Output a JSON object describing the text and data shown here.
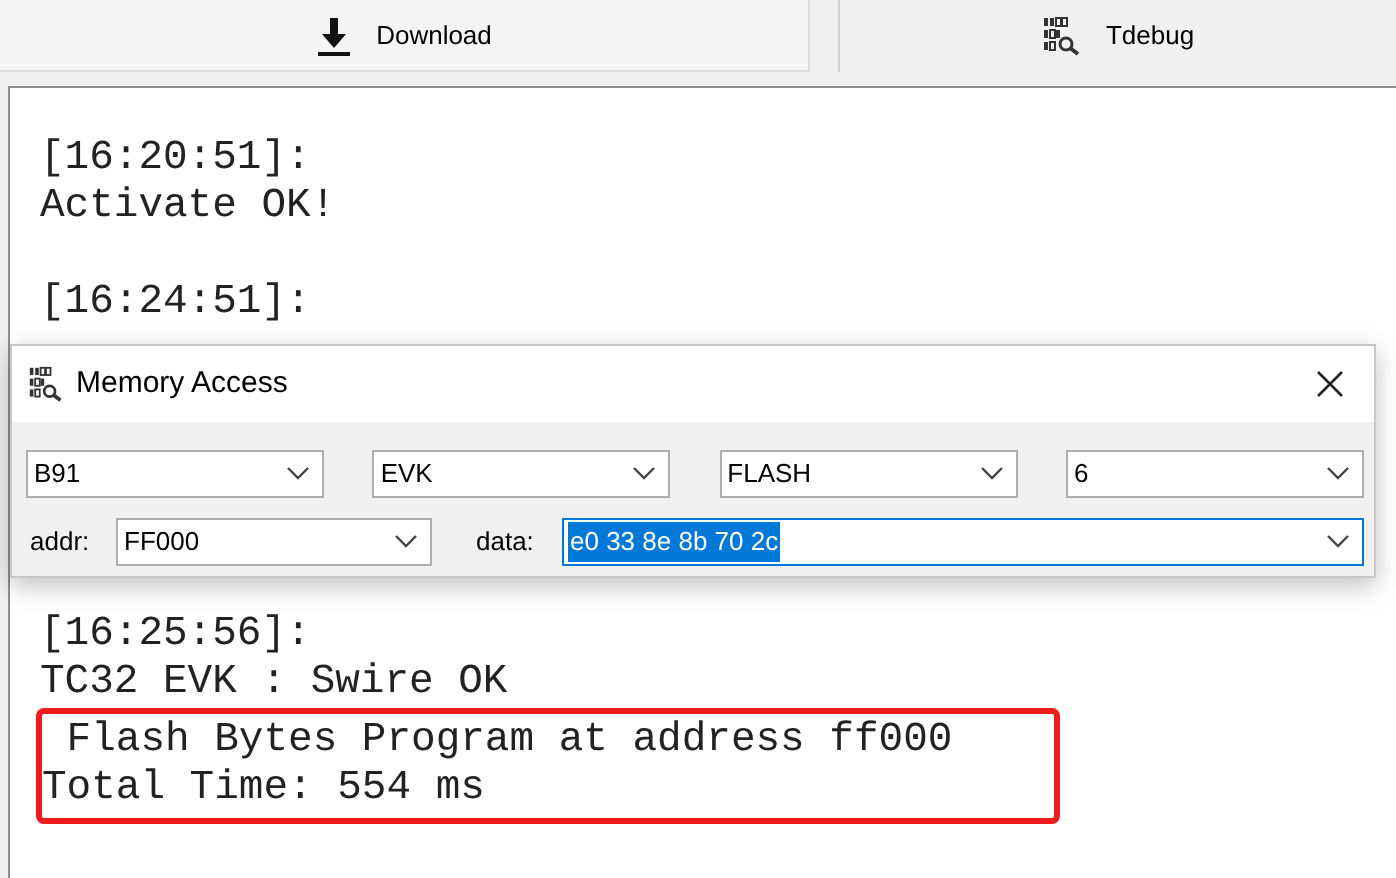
{
  "toolbar": {
    "buttons": [
      {
        "label": "Download"
      },
      {
        "label": "Tdebug"
      }
    ]
  },
  "log": {
    "before": [
      {
        "lines": [
          "[16:20:51]:",
          "Activate OK!"
        ]
      },
      {
        "lines": [
          "[16:24:51]:"
        ]
      }
    ],
    "after": {
      "lines": [
        "[16:25:56]:",
        "TC32 EVK : Swire OK"
      ]
    },
    "highlighted": {
      "lines": [
        " Flash Bytes Program at address ff000",
        "Total Time: 554 ms"
      ]
    }
  },
  "dialog": {
    "title": "Memory Access",
    "selects": [
      "B91",
      "EVK",
      "FLASH",
      "6"
    ],
    "addr": {
      "label": "addr:",
      "value": "FF000"
    },
    "data": {
      "label": "data:",
      "value": "e0 33 8e 8b 70 2c"
    }
  }
}
